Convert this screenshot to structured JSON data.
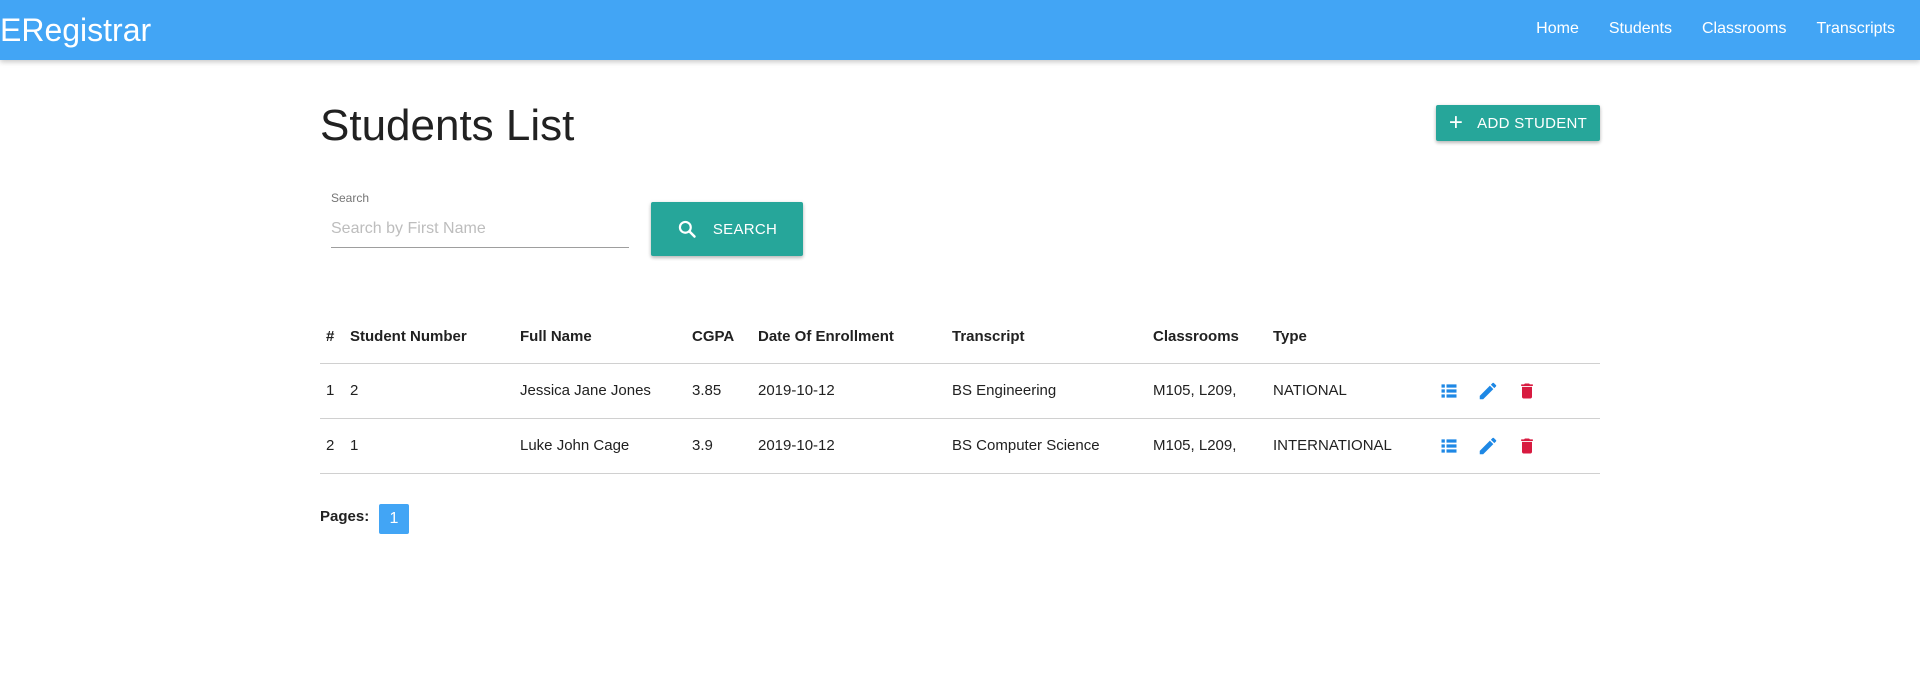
{
  "app": {
    "brand": "ERegistrar",
    "accent_color": "#42a5f5",
    "button_color": "#26a69a",
    "delete_color": "#d81b40"
  },
  "nav": {
    "items": [
      "Home",
      "Students",
      "Classrooms",
      "Transcripts"
    ]
  },
  "page": {
    "title": "Students List",
    "add_button": "Add Student",
    "add_icon": "plus-icon"
  },
  "search": {
    "label": "Search",
    "placeholder": "Search by First Name",
    "value": "",
    "button": "Search",
    "icon": "search-icon"
  },
  "table": {
    "headers": [
      "#",
      "Student Number",
      "Full Name",
      "CGPA",
      "Date Of Enrollment",
      "Transcript",
      "Classrooms",
      "Type",
      ""
    ],
    "rows": [
      {
        "index": "1",
        "student_number": "2",
        "full_name": "Jessica Jane Jones",
        "cgpa": "3.85",
        "enrollment": "2019-10-12",
        "transcript": "BS Engineering",
        "classrooms": "M105, L209,",
        "type": "NATIONAL"
      },
      {
        "index": "2",
        "student_number": "1",
        "full_name": "Luke John Cage",
        "cgpa": "3.9",
        "enrollment": "2019-10-12",
        "transcript": "BS Computer Science",
        "classrooms": "M105, L209,",
        "type": "INTERNATIONAL"
      }
    ],
    "row_actions": [
      "list-icon",
      "edit-icon",
      "delete-icon"
    ]
  },
  "pagination": {
    "label": "Pages:",
    "pages": [
      "1"
    ],
    "current": "1"
  }
}
